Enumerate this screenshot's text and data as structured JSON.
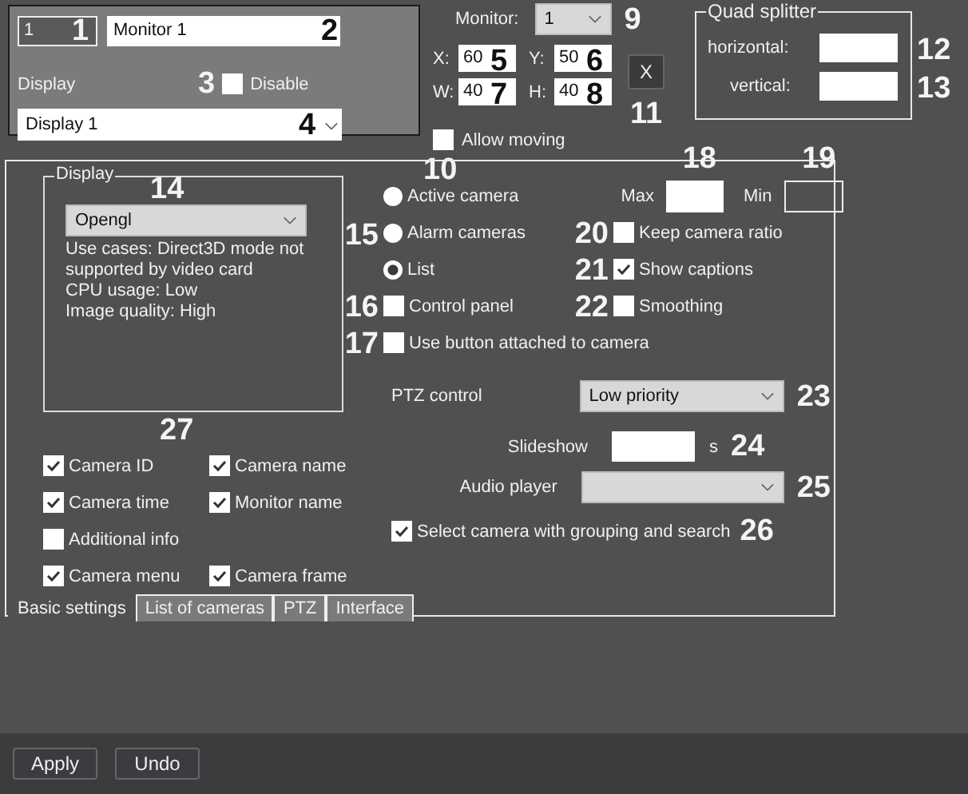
{
  "identity": {
    "number": "1",
    "number_callout": "1",
    "name": "Monitor 1",
    "name_callout": "2",
    "display_label": "Display",
    "disable": {
      "label": "Disable",
      "checked": false,
      "callout": "3"
    },
    "display": {
      "value": "Display 1",
      "callout": "4"
    }
  },
  "position": {
    "monitor_label": "Monitor:",
    "monitor": "1",
    "monitor_callout": "9",
    "fields": [
      {
        "label": "X:",
        "value": "60",
        "callout": "5"
      },
      {
        "label": "Y:",
        "value": "50",
        "callout": "6"
      },
      {
        "label": "W:",
        "value": "40",
        "callout": "7"
      },
      {
        "label": "H:",
        "value": "40",
        "callout": "8"
      }
    ],
    "close": "X",
    "close_callout": "11",
    "allow_moving": {
      "label": "Allow moving",
      "checked": false,
      "callout": "10"
    }
  },
  "quad_splitter": {
    "title": "Quad splitter",
    "fields": [
      {
        "label": "horizontal:",
        "callout": "12"
      },
      {
        "label": "vertical:",
        "callout": "13"
      }
    ]
  },
  "display_group": {
    "title": "Display",
    "renderer": "Opengl",
    "callout": "14",
    "description": [
      "Use cases: Direct3D mode not supported by video card",
      "CPU usage: Low",
      "Image quality: High"
    ]
  },
  "captions": {
    "callout": "27",
    "rows": [
      [
        {
          "label": "Camera ID",
          "checked": true
        },
        {
          "label": "Camera name",
          "checked": true
        }
      ],
      [
        {
          "label": "Camera time",
          "checked": true
        },
        {
          "label": "Monitor name",
          "checked": true
        }
      ],
      [
        {
          "label": "Additional info",
          "checked": false
        }
      ],
      [
        {
          "label": "Camera menu",
          "checked": true
        },
        {
          "label": "Camera frame",
          "checked": true
        }
      ]
    ]
  },
  "source": {
    "callout": "15",
    "options": [
      {
        "label": "Active camera",
        "selected": false
      },
      {
        "label": "Alarm cameras",
        "selected": false
      },
      {
        "label": "List",
        "selected": true
      }
    ]
  },
  "panel_options": [
    {
      "label": "Control panel",
      "checked": false,
      "callout": "16"
    },
    {
      "label": "Use button attached to camera",
      "checked": false,
      "callout": "17"
    }
  ],
  "size": [
    {
      "label": "Max",
      "callout": "18",
      "disabled": false
    },
    {
      "label": "Min",
      "callout": "19",
      "disabled": true
    }
  ],
  "view_options": [
    {
      "label": "Keep camera ratio",
      "checked": false,
      "callout": "20"
    },
    {
      "label": "Show captions",
      "checked": true,
      "callout": "21"
    },
    {
      "label": "Smoothing",
      "checked": false,
      "callout": "22"
    }
  ],
  "ptz": {
    "label": "PTZ control",
    "value": "Low priority",
    "callout": "23"
  },
  "slideshow": {
    "label": "Slideshow",
    "unit": "s",
    "callout": "24"
  },
  "audio": {
    "label": "Audio player",
    "callout": "25"
  },
  "grouping": {
    "label": "Select camera with grouping and search",
    "checked": true,
    "callout": "26"
  },
  "tabs": [
    {
      "label": "Basic settings",
      "selected": true
    },
    {
      "label": "List of cameras",
      "selected": false
    },
    {
      "label": "PTZ",
      "selected": false
    },
    {
      "label": "Interface",
      "selected": false
    }
  ],
  "buttons": [
    "Apply",
    "Undo"
  ]
}
